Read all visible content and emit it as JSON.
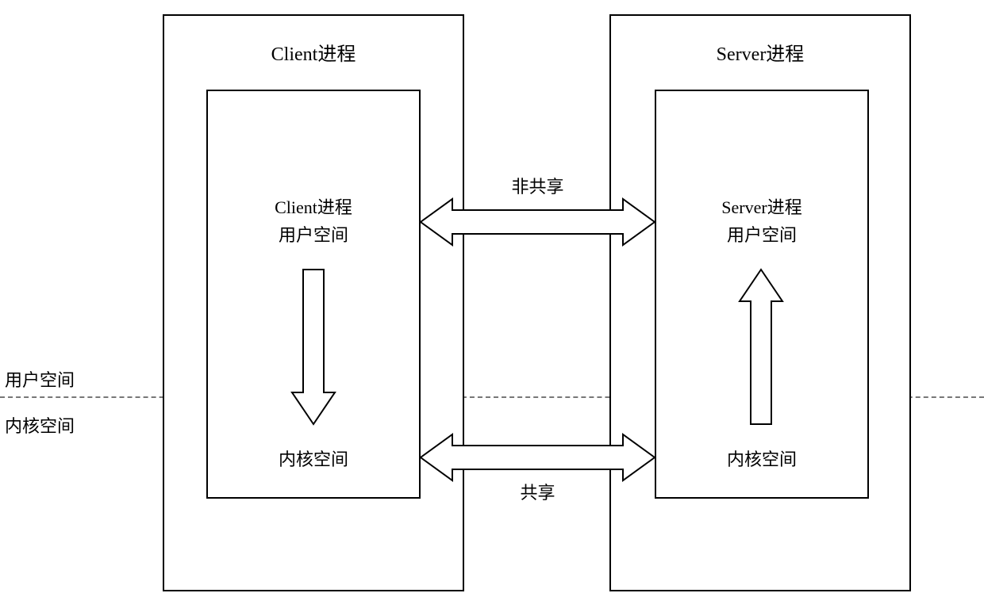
{
  "client": {
    "title": "Client进程",
    "user_space_box": "Client进程\n用户空间",
    "kernel_box": "内核空间"
  },
  "server": {
    "title": "Server进程",
    "user_space_box": "Server进程\n用户空间",
    "kernel_box": "内核空间"
  },
  "arrows": {
    "non_shared": "非共享",
    "shared": "共享"
  },
  "labels": {
    "user_space": "用户空间",
    "kernel_space": "内核空间"
  }
}
